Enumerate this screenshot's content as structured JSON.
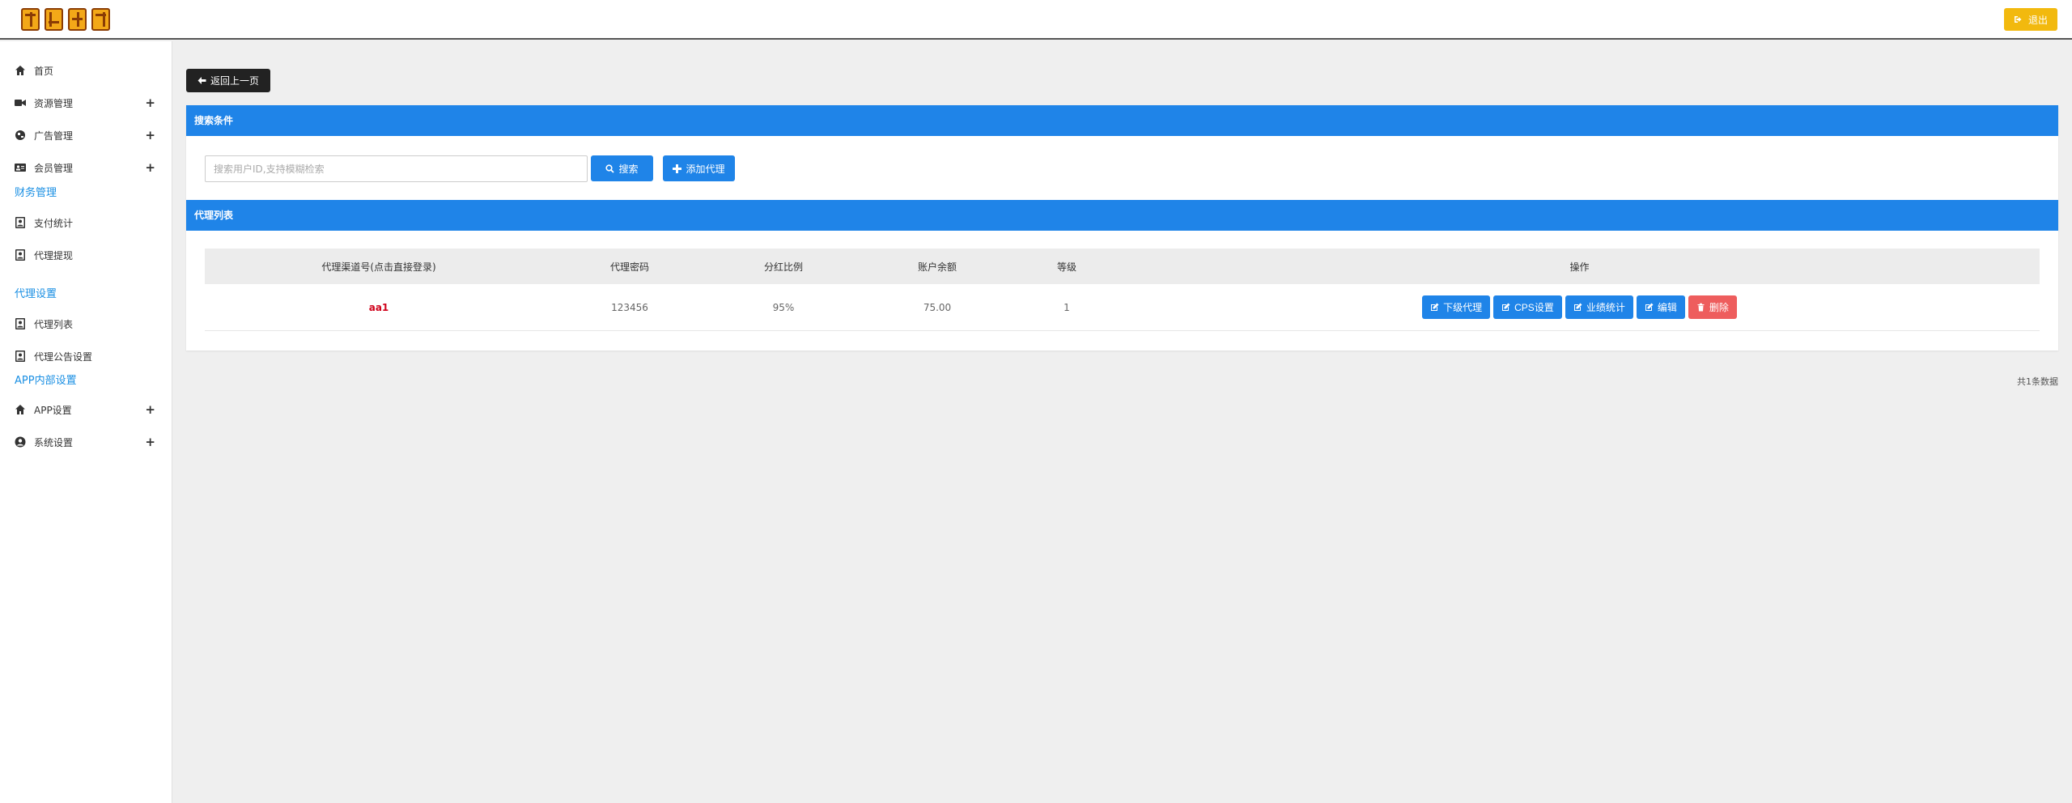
{
  "header": {
    "logo_text": "视频",
    "logout_label": "退出"
  },
  "sidebar": {
    "items": [
      {
        "label": "首页",
        "icon": "home-icon",
        "expandable": false
      },
      {
        "label": "资源管理",
        "icon": "video-camera-icon",
        "expandable": true
      },
      {
        "label": "广告管理",
        "icon": "globe-icon",
        "expandable": true
      },
      {
        "label": "会员管理",
        "icon": "id-card-icon",
        "expandable": true
      }
    ],
    "finance_title": "财务管理",
    "finance_items": [
      {
        "label": "支付统计",
        "icon": "user-badge-icon"
      },
      {
        "label": "代理提现",
        "icon": "user-badge-icon"
      }
    ],
    "agent_title": "代理设置",
    "agent_items": [
      {
        "label": "代理列表",
        "icon": "user-badge-icon"
      },
      {
        "label": "代理公告设置",
        "icon": "user-badge-icon"
      }
    ],
    "app_title": "APP内部设置",
    "app_items": [
      {
        "label": "APP设置",
        "icon": "home-icon",
        "expandable": true
      },
      {
        "label": "系统设置",
        "icon": "user-circle-icon",
        "expandable": true
      }
    ],
    "plus_symbol": "+"
  },
  "main": {
    "back_label": "返回上一页",
    "search_panel_title": "搜索条件",
    "search_placeholder": "搜索用户ID,支持模糊检索",
    "search_button": "搜索",
    "add_button": "添加代理",
    "list_panel_title": "代理列表",
    "columns": [
      "代理渠道号(点击直接登录)",
      "代理密码",
      "分红比例",
      "账户余额",
      "等级",
      "操作"
    ],
    "rows": [
      {
        "code": "aa1",
        "password": "123456",
        "ratio": "95%",
        "balance": "75.00",
        "level": "1"
      }
    ],
    "actions": [
      "下级代理",
      "CPS设置",
      "业绩统计",
      "编辑",
      "删除"
    ],
    "total_text": "共1条数据"
  },
  "colors": {
    "primary": "#1f84e8",
    "danger": "#ee5d5d",
    "warning": "#f2b90e",
    "link_red": "#d0021b",
    "section_blue": "#1a8fe3"
  }
}
